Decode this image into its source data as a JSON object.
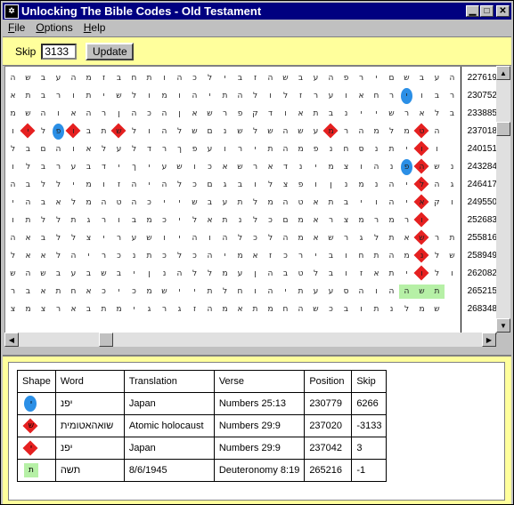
{
  "window": {
    "title": "Unlocking The Bible Codes - Old Testament",
    "app_icon": "torah-icon"
  },
  "menu": {
    "items": [
      "File",
      "Options",
      "Help"
    ],
    "underline": [
      "F",
      "O",
      "H"
    ]
  },
  "toolbar": {
    "skip_label": "Skip",
    "skip_value": "3133",
    "update_label": "Update"
  },
  "colors": {
    "oval": "#2b8fe6",
    "diamond": "#e52020",
    "rect": "#b6f0a6",
    "highlight": "#ffff9c",
    "titlebar": "#000080"
  },
  "grid": {
    "rows": [
      {
        "num": "227619",
        "letters": "השבעהמזבחתוהכליבזהשבעהפריםשבעה"
      },
      {
        "num": "230752",
        "letters": "אתברותישלומוהיתהלולזרעואחריוברי"
      },
      {
        "num": "233885",
        "letters": "משהואהרןהכהןאשרפקדואתבניישראלבמ"
      },
      {
        "num": "237018",
        "letters": "ושלוםבתבלוהלשםנשלשהשעשרהמלמשה"
      },
      {
        "num": "240151",
        "letters": "לבםהואלעלדרךפעוריתהמפנחסנתיהו"
      },
      {
        "num": "243284",
        "letters": "ולברעבדיךיעשוכאשראדנימצוהנספשנ"
      },
      {
        "num": "246417",
        "letters": "הבללימוזהיהלכםגבולצפוןנמנהימהגר"
      },
      {
        "num": "249550",
        "letters": "יהבאלמהטהכיישבעתלמהטאתביוהירקו"
      },
      {
        "num": "252683",
        "letters": "ותללתגרובמכילאתנלכםמארצמרמר"
      },
      {
        "num": "255816",
        "letters": "האבללצירעשויהוהלכלהמאשרגלתאשרת"
      },
      {
        "num": "258949",
        "letters": "לאאלהירכנתכלכהימאזכריבוחתהמשלש"
      },
      {
        "num": "262082",
        "letters": "שהשבעבשביןנהללמעןהבטלבוזאתיולות"
      },
      {
        "num": "265215",
        "letters": "רבאתחאכיכמשייתלחוהיתעעסהוהתשה"
      },
      {
        "num": "268348",
        "letters": "צמצראבתמיגרגזהמאתמחהשכבותנלמש"
      }
    ],
    "marks": [
      {
        "row": 1,
        "col": 26,
        "shape": "oval",
        "ch": "י"
      },
      {
        "row": 3,
        "col": 1,
        "shape": "diamond",
        "ch": "י"
      },
      {
        "row": 3,
        "col": 4,
        "shape": "diamond",
        "ch": "ו"
      },
      {
        "row": 3,
        "col": 7,
        "shape": "diamond",
        "ch": "ש"
      },
      {
        "row": 3,
        "col": 21,
        "shape": "diamond",
        "ch": "מ"
      },
      {
        "row": 3,
        "col": 3,
        "shape": "oval",
        "ch": "פ"
      },
      {
        "row": 5,
        "col": 26,
        "shape": "oval",
        "ch": "פ"
      },
      {
        "row": 3,
        "col": 27,
        "shape": "diamond",
        "ch": "ט"
      },
      {
        "row": 4,
        "col": 27,
        "shape": "diamond",
        "ch": "ו"
      },
      {
        "row": 5,
        "col": 27,
        "shape": "diamond",
        "ch": "ה"
      },
      {
        "row": 6,
        "col": 27,
        "shape": "diamond",
        "ch": "ל"
      },
      {
        "row": 7,
        "col": 27,
        "shape": "diamond",
        "ch": "א"
      },
      {
        "row": 8,
        "col": 27,
        "shape": "diamond",
        "ch": "ו"
      },
      {
        "row": 9,
        "col": 27,
        "shape": "diamond",
        "ch": "ש"
      },
      {
        "row": 10,
        "col": 27,
        "shape": "diamond",
        "ch": "נ"
      },
      {
        "row": 11,
        "col": 27,
        "shape": "diamond",
        "ch": "ו"
      },
      {
        "row": 12,
        "col": 28,
        "shape": "rect",
        "ch": "ת"
      },
      {
        "row": 12,
        "col": 27,
        "shape": "rect",
        "ch": "ש"
      },
      {
        "row": 12,
        "col": 26,
        "shape": "rect",
        "ch": "ה"
      }
    ]
  },
  "legend": {
    "headers": [
      "Shape",
      "Word",
      "Translation",
      "Verse",
      "Position",
      "Skip"
    ],
    "rows": [
      {
        "shape": "oval",
        "ch": "י",
        "word": "יפנ",
        "translation": "Japan",
        "verse": "Numbers 25:13",
        "position": "230779",
        "skip": "6266"
      },
      {
        "shape": "diamond",
        "ch": "ש",
        "word": "שואהאטומית",
        "translation": "Atomic holocaust",
        "verse": "Numbers 29:9",
        "position": "237020",
        "skip": "-3133"
      },
      {
        "shape": "diamond",
        "ch": "י",
        "word": "יפנ",
        "translation": "Japan",
        "verse": "Numbers 29:9",
        "position": "237042",
        "skip": "3"
      },
      {
        "shape": "rect",
        "ch": "ת",
        "word": "תשה",
        "translation": "8/6/1945",
        "verse": "Deuteronomy 8:19",
        "position": "265216",
        "skip": "-1"
      }
    ]
  }
}
